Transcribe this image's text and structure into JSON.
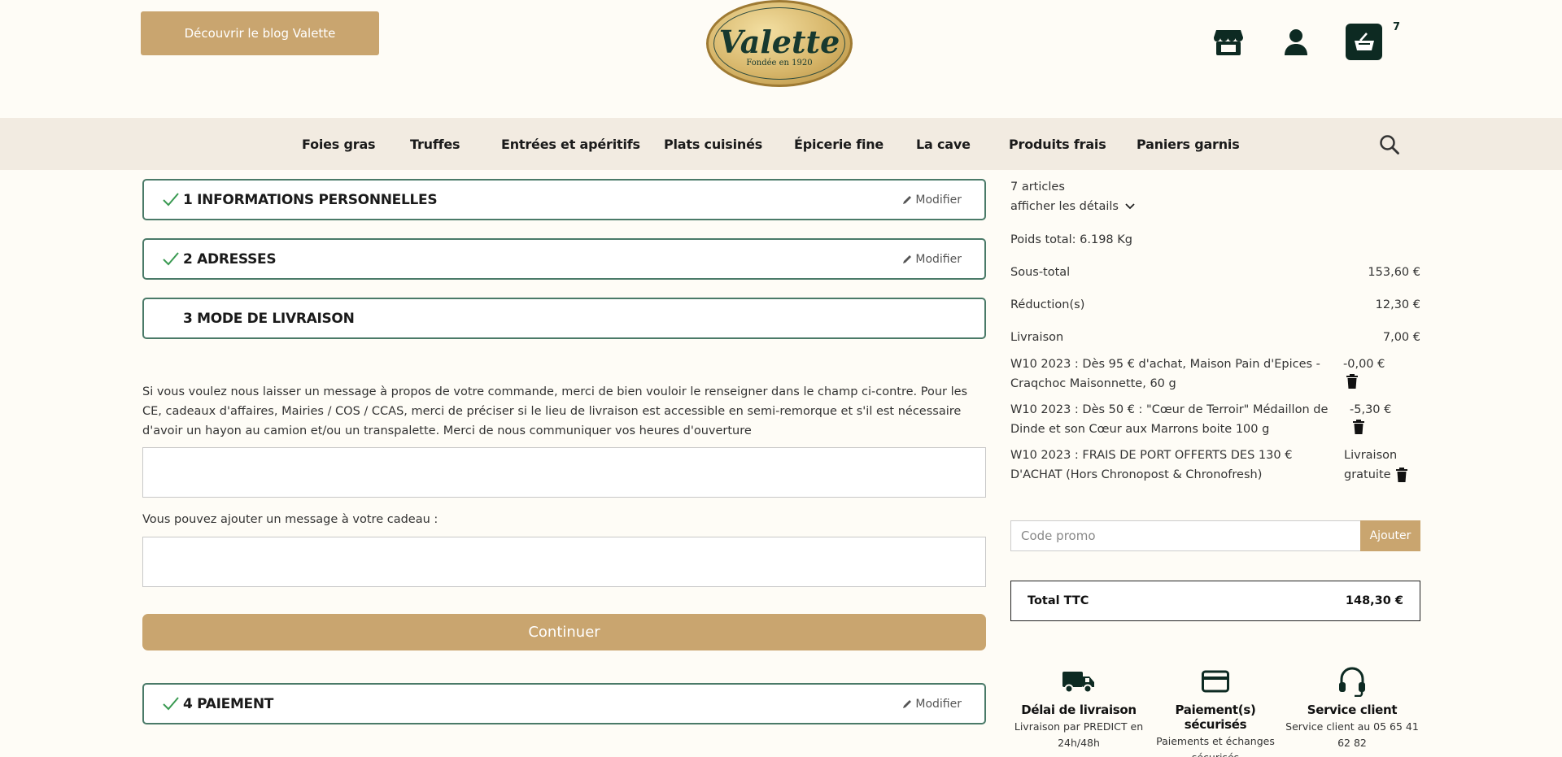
{
  "header": {
    "blog_button": "Découvrir le blog Valette",
    "logo_text": "Valette",
    "logo_sub": "Fondée en 1920",
    "cart_count": "7"
  },
  "nav": {
    "items": [
      "Foies gras",
      "Truffes",
      "Entrées et apéritifs",
      "Plats cuisinés",
      "Épicerie fine",
      "La cave",
      "Produits frais",
      "Paniers garnis"
    ]
  },
  "steps": {
    "step1": {
      "title": "1 INFORMATIONS PERSONNELLES",
      "modify": "Modifier"
    },
    "step2": {
      "title": "2 ADRESSES",
      "modify": "Modifier"
    },
    "step3": {
      "title": "3 MODE DE LIVRAISON"
    },
    "step4": {
      "title": "4 PAIEMENT",
      "modify": "Modifier"
    }
  },
  "delivery": {
    "message_info": "Si vous voulez nous laisser un message à propos de votre commande, merci de bien vouloir le renseigner dans le champ ci-contre. Pour les CE, cadeaux d'affaires, Mairies / COS / CCAS, merci de préciser si le lieu de livraison est accessible en semi-remorque et s'il est nécessaire d'avoir un hayon au camion et/ou un transpalette. Merci de nous communiquer vos heures d'ouverture",
    "message_value": "",
    "gift_label": "Vous pouvez ajouter un message à votre cadeau :",
    "gift_value": "",
    "continue_button": "Continuer"
  },
  "summary": {
    "article_count": "7 articles",
    "show_details": "afficher les détails",
    "weight": "Poids total: 6.198 Kg",
    "subtotal_label": "Sous-total",
    "subtotal_value": "153,60 €",
    "reduction_label": "Réduction(s)",
    "reduction_value": "12,30 €",
    "shipping_label": "Livraison",
    "shipping_value": "7,00 €",
    "promos": [
      {
        "text": "W10 2023 : Dès 95 € d'achat, Maison Pain d'Epices - Craqchoc Maisonnette, 60 g",
        "amount": "-0,00 €"
      },
      {
        "text": "W10 2023 : Dès 50 € : \"Cœur de Terroir\" Médaillon de Dinde et son Cœur aux Marrons boite 100 g",
        "amount": "-5,30 €"
      },
      {
        "text": "W10 2023 : FRAIS DE PORT OFFERTS DES 130 € D'ACHAT (Hors Chronopost & Chronofresh)",
        "amount_line1": "Livraison",
        "amount_line2": "gratuite"
      }
    ],
    "promo_placeholder": "Code promo",
    "promo_button": "Ajouter",
    "total_label": "Total TTC",
    "total_value": "148,30 €"
  },
  "reassurance": [
    {
      "icon": "truck-icon",
      "title": "Délai de livraison",
      "text": "Livraison par PREDICT en 24h/48h"
    },
    {
      "icon": "credit-card-icon",
      "title": "Paiement(s) sécurisés",
      "text": "Paiements et échanges sécurisés"
    },
    {
      "icon": "headset-icon",
      "title": "Service client",
      "text": "Service client au 05 65 41 62 82"
    }
  ],
  "colors": {
    "accent_gold": "#c9a56f",
    "dark_green": "#0d2a22",
    "step_border": "#4a7a68",
    "nav_bg": "#f2ebe1",
    "page_bg": "#fefcf6"
  }
}
